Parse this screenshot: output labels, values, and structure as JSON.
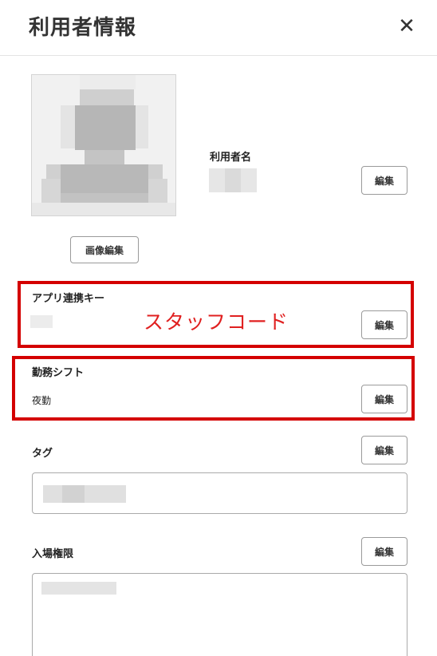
{
  "header": {
    "title": "利用者情報",
    "close_glyph": "✕"
  },
  "profile": {
    "name_label": "利用者名",
    "image_edit_label": "画像編集",
    "edit_label": "編集"
  },
  "app_key": {
    "label": "アプリ連携キー",
    "annotation": "スタッフコード",
    "edit_label": "編集"
  },
  "shift": {
    "label": "勤務シフト",
    "value": "夜勤",
    "edit_label": "編集"
  },
  "tags": {
    "label": "タグ",
    "edit_label": "編集"
  },
  "access": {
    "label": "入場権限",
    "edit_label": "編集"
  },
  "colors": {
    "highlight": "#d40000",
    "annotation": "#e02020"
  }
}
